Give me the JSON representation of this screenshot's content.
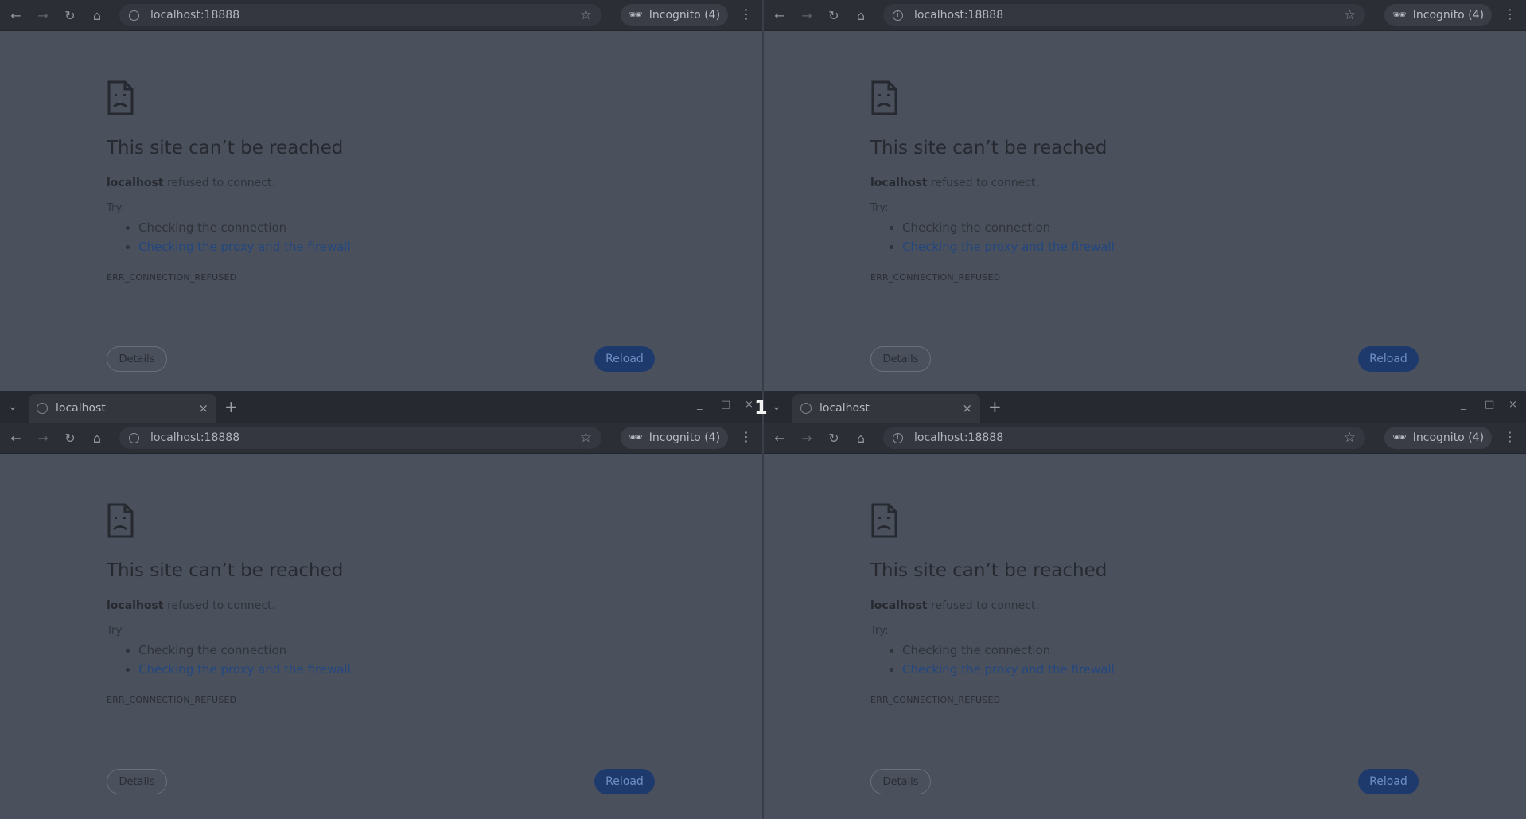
{
  "tab": {
    "title": "localhost",
    "close": "×",
    "new_tab": "+"
  },
  "window_controls": {
    "minimize": "_",
    "maximize": "□",
    "close": "×"
  },
  "toolbar": {
    "url": "localhost:18888",
    "incognito_label": "Incognito (4)"
  },
  "error_page": {
    "heading": "This site can’t be reached",
    "host": "localhost",
    "message_rest": " refused to connect.",
    "try_label": "Try:",
    "suggestions": [
      "Checking the connection",
      "Checking the proxy and the firewall"
    ],
    "error_code": "ERR_CONNECTION_REFUSED",
    "details_button": "Details",
    "reload_button": "Reload"
  },
  "workspace_badge": "1",
  "colors": {
    "reload_bg": "#1e3a6d",
    "link": "#23477f",
    "page_bg": "#4b505d"
  }
}
